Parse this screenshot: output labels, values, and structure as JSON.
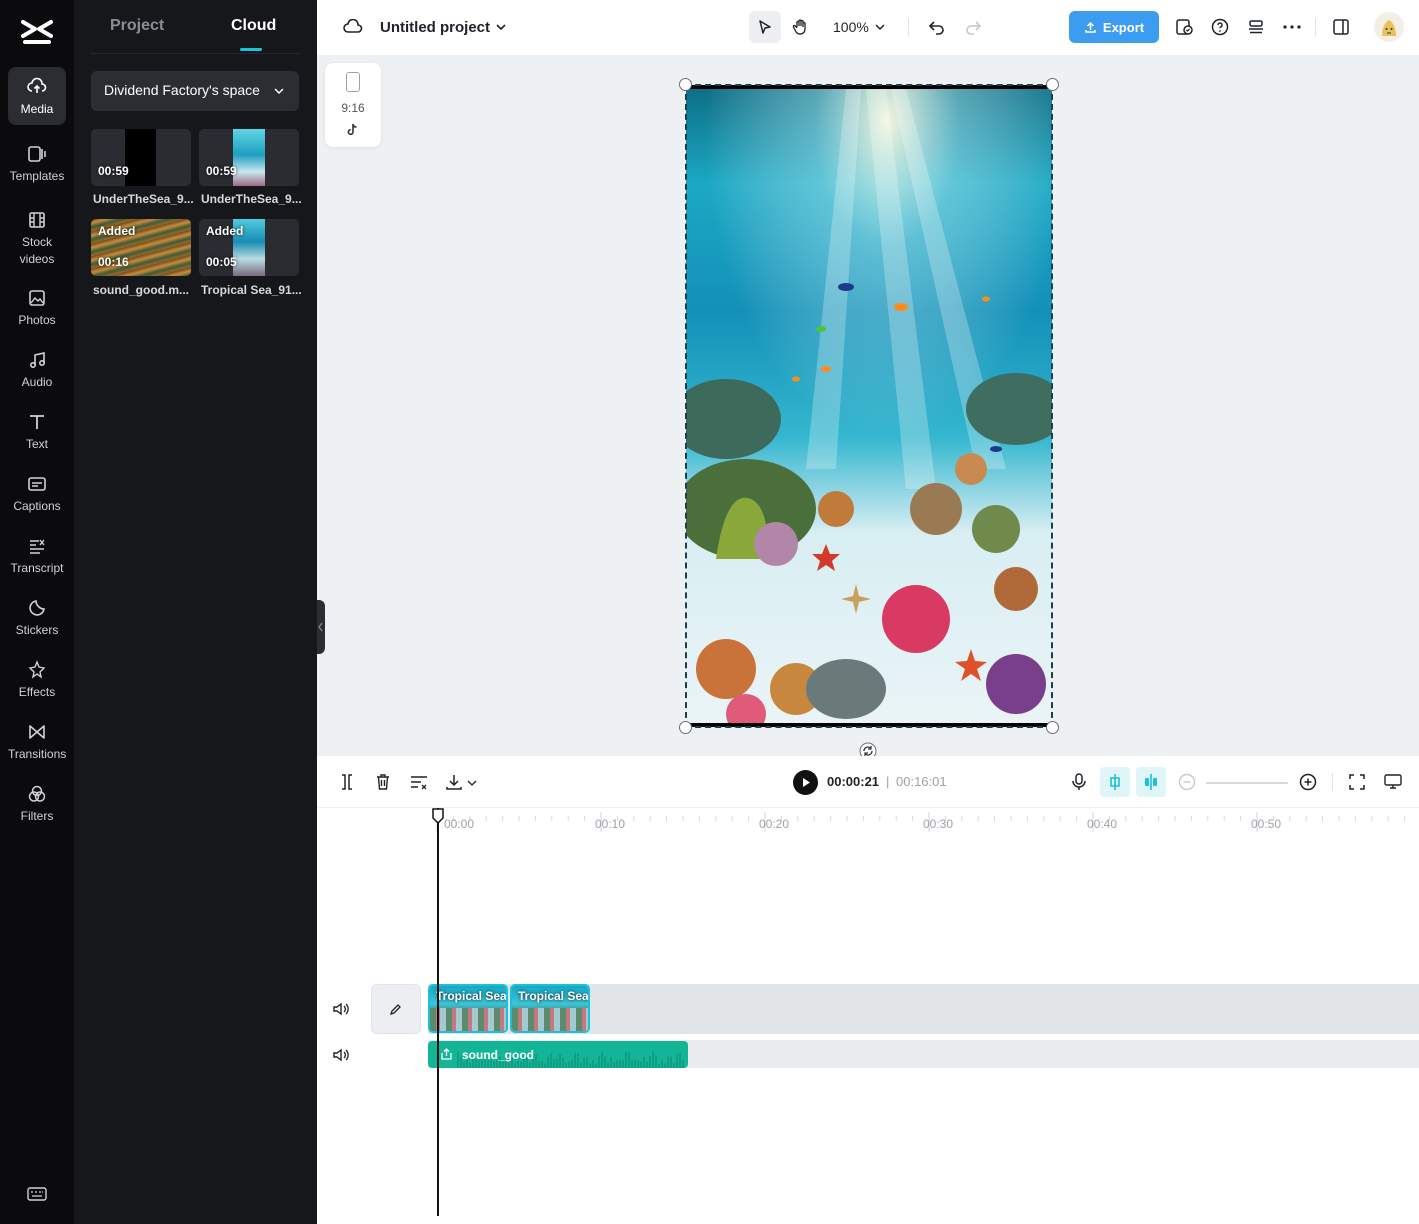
{
  "rail": {
    "items": [
      {
        "label": "Media",
        "icon": "cloud-upload-icon"
      },
      {
        "label": "Templates",
        "icon": "templates-icon"
      },
      {
        "label": "Stock videos",
        "icon": "film-icon"
      },
      {
        "label": "Photos",
        "icon": "image-icon"
      },
      {
        "label": "Audio",
        "icon": "music-note-icon"
      },
      {
        "label": "Text",
        "icon": "text-t-icon"
      },
      {
        "label": "Captions",
        "icon": "captions-icon"
      },
      {
        "label": "Transcript",
        "icon": "transcript-icon"
      },
      {
        "label": "Stickers",
        "icon": "sticker-icon"
      },
      {
        "label": "Effects",
        "icon": "sparkle-icon"
      },
      {
        "label": "Transitions",
        "icon": "transition-icon"
      },
      {
        "label": "Filters",
        "icon": "filters-icon"
      }
    ]
  },
  "panel": {
    "tabs": [
      "Project",
      "Cloud"
    ],
    "active_tab": "Cloud",
    "space_name": "Dividend Factory's space",
    "media": [
      {
        "badge_top": "",
        "duration": "00:59",
        "name": "UnderTheSea_9..."
      },
      {
        "badge_top": "",
        "duration": "00:59",
        "name": "UnderTheSea_9..."
      },
      {
        "badge_top": "Added",
        "duration": "00:16",
        "name": "sound_good.m..."
      },
      {
        "badge_top": "Added",
        "duration": "00:05",
        "name": "Tropical Sea_91..."
      }
    ]
  },
  "topbar": {
    "project_title": "Untitled project",
    "zoom": "100%",
    "export_label": "Export"
  },
  "canvas": {
    "aspect_ratio": "9:16"
  },
  "timeline": {
    "current_time": "00:00:21",
    "separator": "|",
    "total_time": "00:16:01",
    "ruler": [
      "00:00",
      "00:10",
      "00:20",
      "00:30",
      "00:40",
      "00:50"
    ],
    "video_clips": [
      "Tropical Sea",
      "Tropical Sea"
    ],
    "audio_clip": "sound_good"
  },
  "colors": {
    "accent": "#19c2d8",
    "export": "#3b9cf0",
    "audio_clip": "#13b597",
    "rail_bg": "#0b0b0d",
    "panel_bg": "#16171a"
  }
}
